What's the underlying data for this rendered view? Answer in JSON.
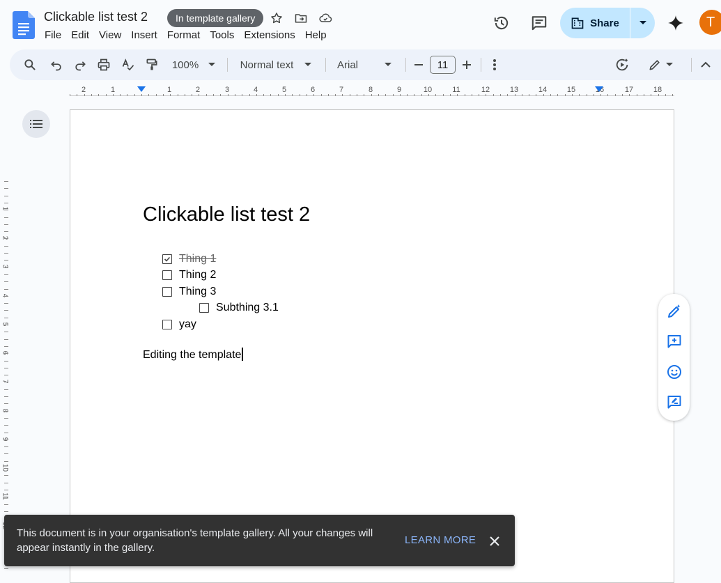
{
  "header": {
    "doc_title": "Clickable list test 2",
    "gallery_chip": "In template gallery",
    "menu": [
      "File",
      "Edit",
      "View",
      "Insert",
      "Format",
      "Tools",
      "Extensions",
      "Help"
    ],
    "share_label": "Share",
    "avatar_letter": "T"
  },
  "toolbar": {
    "zoom": "100%",
    "style": "Normal text",
    "font": "Arial",
    "font_size": "11"
  },
  "ruler": {
    "labels": [
      "2",
      "1",
      "1",
      "2",
      "3",
      "4",
      "5",
      "6",
      "7",
      "8",
      "9",
      "10",
      "11",
      "12",
      "13",
      "14",
      "15",
      "16",
      "17",
      "18"
    ],
    "vlabels": [
      "1",
      "2",
      "3",
      "4",
      "5",
      "6",
      "7",
      "8",
      "9",
      "10",
      "11",
      "12"
    ]
  },
  "document": {
    "heading": "Clickable list test 2",
    "checklist": [
      {
        "text": "Thing 1",
        "checked": true,
        "level": 0
      },
      {
        "text": "Thing 2",
        "checked": false,
        "level": 0
      },
      {
        "text": "Thing 3",
        "checked": false,
        "level": 0
      },
      {
        "text": "Subthing 3.1",
        "checked": false,
        "level": 1
      },
      {
        "text": "yay",
        "checked": false,
        "level": 0
      }
    ],
    "body_text": "Editing the template"
  },
  "snackbar": {
    "message": "This document is in your organisation's template gallery. All your changes will appear instantly in the gallery.",
    "action": "LEARN MORE"
  },
  "colors": {
    "share_bg": "#c2e7ff",
    "avatar_bg": "#e8710a",
    "accent_blue": "#1a73e8",
    "snackbar_bg": "#323232",
    "link_blue": "#8ab4f8"
  }
}
